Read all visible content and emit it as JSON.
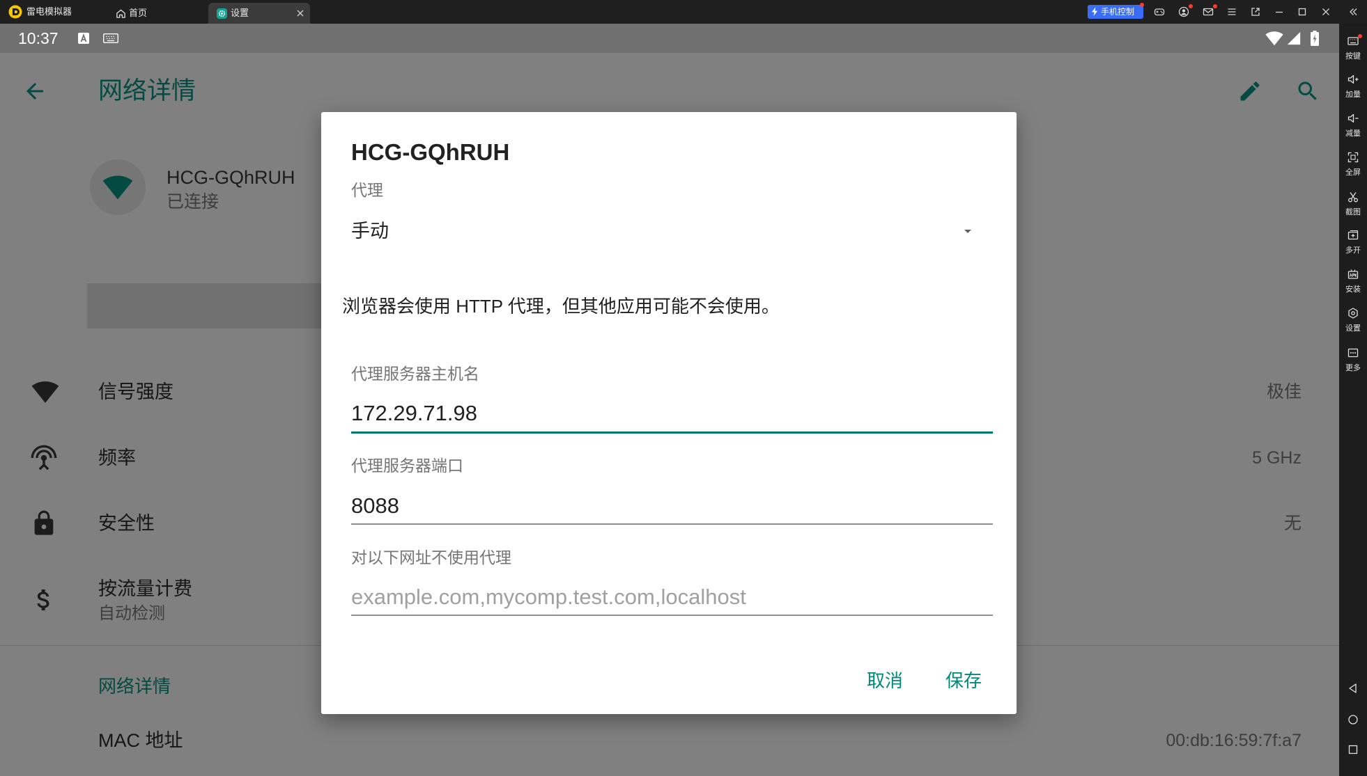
{
  "emulator": {
    "app_name": "雷电模拟器",
    "tabs": [
      {
        "label": "首页",
        "icon": "home-icon"
      },
      {
        "label": "设置",
        "icon": "gear-icon",
        "active": true
      }
    ],
    "phone_control_label": "手机控制",
    "sidebar": [
      {
        "label": "按键",
        "icon": "keyboard-icon"
      },
      {
        "label": "加量",
        "icon": "volume-up-icon"
      },
      {
        "label": "减量",
        "icon": "volume-down-icon"
      },
      {
        "label": "全屏",
        "icon": "fullscreen-icon"
      },
      {
        "label": "截图",
        "icon": "scissors-icon"
      },
      {
        "label": "多开",
        "icon": "multi-instance-icon"
      },
      {
        "label": "安装",
        "icon": "apk-install-icon"
      },
      {
        "label": "设置",
        "icon": "settings-icon"
      },
      {
        "label": "更多",
        "icon": "more-icon"
      }
    ]
  },
  "status_bar": {
    "time": "10:37"
  },
  "page": {
    "title": "网络详情",
    "network": {
      "ssid": "HCG-GQhRUH",
      "status": "已连接"
    },
    "rows": [
      {
        "label": "信号强度",
        "value": "极佳",
        "icon": "wifi-signal-icon"
      },
      {
        "label": "频率",
        "value": "5 GHz",
        "icon": "antenna-icon"
      },
      {
        "label": "安全性",
        "value": "无",
        "icon": "lock-icon"
      },
      {
        "label": "按流量计费",
        "sub": "自动检测",
        "icon": "dollar-icon"
      }
    ],
    "section_header": "网络详情",
    "mac": {
      "label": "MAC 地址",
      "value": "00:db:16:59:7f:a7"
    }
  },
  "dialog": {
    "title": "HCG-GQhRUH",
    "proxy_label": "代理",
    "proxy_mode": "手动",
    "info": "浏览器会使用 HTTP 代理，但其他应用可能不会使用。",
    "hostname": {
      "label": "代理服务器主机名",
      "value": "172.29.71.98"
    },
    "port": {
      "label": "代理服务器端口",
      "value": "8088"
    },
    "bypass": {
      "label": "对以下网址不使用代理",
      "placeholder": "example.com,mycomp.test.com,localhost"
    },
    "cancel": "取消",
    "save": "保存"
  },
  "colors": {
    "accent": "#00897b",
    "phone_control_badge": "#3a6cf4"
  }
}
